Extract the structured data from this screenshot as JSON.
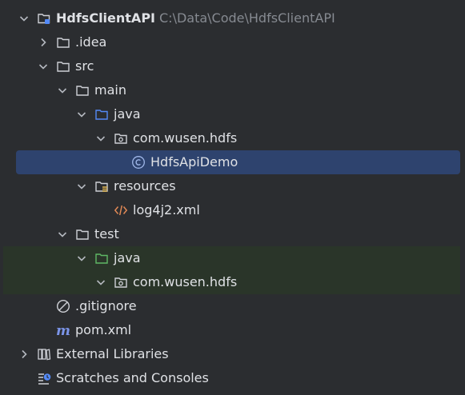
{
  "tree": {
    "project": {
      "name": "HdfsClientAPI",
      "path": "C:\\Data\\Code\\HdfsClientAPI"
    },
    "idea": "idea",
    "src": "src",
    "main": "main",
    "main_java": "java",
    "main_package": "com.wusen.hdfs",
    "class_file": "HdfsApiDemo",
    "resources": "resources",
    "log_file": "log4j2.xml",
    "test": "test",
    "test_java": "java",
    "test_package": "com.wusen.hdfs",
    "gitignore": "gitignore",
    "pom": "pom.xml",
    "external_libraries": "External Libraries",
    "scratches": "Scratches and Consoles"
  },
  "colors": {
    "background": "#2b2d30",
    "selection": "#2e436e",
    "test_highlight": "#2a3529",
    "text": "#dfe1e5",
    "path_text": "#868a91",
    "source_folder": "#548af7",
    "test_folder": "#5fb865",
    "xml_icon": "#e08855",
    "maven_icon": "#7b94e8"
  }
}
